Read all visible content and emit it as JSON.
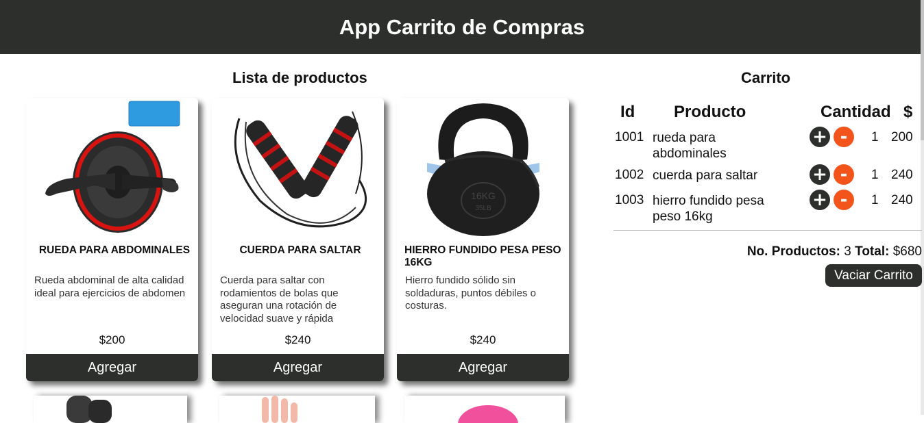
{
  "app": {
    "title": "App Carrito de Compras"
  },
  "products_section": {
    "title": "Lista de productos"
  },
  "cart_section": {
    "title": "Carrito"
  },
  "products": [
    {
      "name": "RUEDA PARA ABDOMINALES",
      "description": "Rueda abdominal de alta calidad ideal para ejercicios de abdomen",
      "price": "$200",
      "button": "Agregar",
      "image": "ab-wheel-icon"
    },
    {
      "name": "CUERDA PARA SALTAR",
      "description": "Cuerda para saltar con rodamientos de bolas que aseguran una rotación de velocidad suave y rápida",
      "price": "$240",
      "button": "Agregar",
      "image": "jump-rope-icon"
    },
    {
      "name": "HIERRO FUNDIDO PESA PESO 16KG",
      "description": "Hierro fundido sólido sin soldaduras, puntos débiles o costuras.",
      "price": "$240",
      "button": "Agregar",
      "image": "kettlebell-icon"
    }
  ],
  "cart": {
    "headers": {
      "id": "Id",
      "product": "Producto",
      "quantity": "Cantidad",
      "amount": "$"
    },
    "rows": [
      {
        "id": "1001",
        "product": "rueda para abdominales",
        "quantity": "1",
        "amount": "200"
      },
      {
        "id": "1002",
        "product": "cuerda para saltar",
        "quantity": "1",
        "amount": "240"
      },
      {
        "id": "1003",
        "product": "hierro fundido pesa peso 16kg",
        "quantity": "1",
        "amount": "240"
      }
    ],
    "plus_label": "+",
    "minus_label": "-",
    "summary": {
      "count_label": "No. Productos:",
      "count": "3",
      "total_label": "Total:",
      "total": "$680"
    },
    "clear_button": "Vaciar Carrito"
  },
  "colors": {
    "header": "#2c2f2c",
    "accent": "#f2541b",
    "button": "#2c2f2c"
  }
}
